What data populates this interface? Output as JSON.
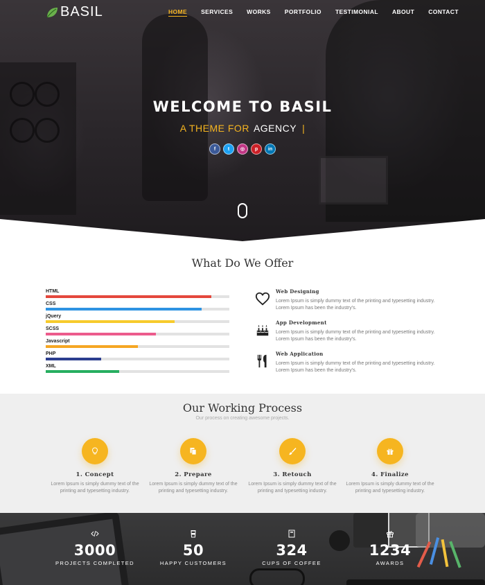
{
  "brand": {
    "name": "BASIL"
  },
  "nav": [
    {
      "label": "HOME",
      "active": true
    },
    {
      "label": "SERVICES"
    },
    {
      "label": "WORKS"
    },
    {
      "label": "PORTFOLIO"
    },
    {
      "label": "TESTIMONIAL"
    },
    {
      "label": "ABOUT"
    },
    {
      "label": "CONTACT"
    }
  ],
  "hero": {
    "title": "WELCOME TO BASIL",
    "sub_prefix": "A THEME FOR",
    "sub_word": "AGENCY",
    "cursor": "|",
    "social": [
      {
        "icon": "facebook-icon",
        "glyph": "f",
        "color": "#3b5998"
      },
      {
        "icon": "twitter-icon",
        "glyph": "t",
        "color": "#1da1f2"
      },
      {
        "icon": "instagram-icon",
        "glyph": "◎",
        "color": "#c13584"
      },
      {
        "icon": "pinterest-icon",
        "glyph": "p",
        "color": "#cb2027"
      },
      {
        "icon": "linkedin-icon",
        "glyph": "in",
        "color": "#0077b5"
      }
    ]
  },
  "offer": {
    "title": "What Do We Offer",
    "skills": [
      {
        "label": "HTML",
        "percent": 90,
        "color": "#e4473c"
      },
      {
        "label": "CSS",
        "percent": 85,
        "color": "#2e93e2"
      },
      {
        "label": "jQuery",
        "percent": 70,
        "color": "#f7cb2c"
      },
      {
        "label": "SCSS",
        "percent": 60,
        "color": "#ec5b8c"
      },
      {
        "label": "Javascript",
        "percent": 50,
        "color": "#f5a623"
      },
      {
        "label": "PHP",
        "percent": 30,
        "color": "#2c3e8f"
      },
      {
        "label": "XML",
        "percent": 40,
        "color": "#27ae60"
      }
    ],
    "services": [
      {
        "name": "Web Designing",
        "icon": "heart-icon",
        "desc": "Lorem Ipsum is simply dummy text of the printing and typesetting industry. Lorem Ipsum has been the industry's."
      },
      {
        "name": "App Development",
        "icon": "cake-icon",
        "desc": "Lorem Ipsum is simply dummy text of the printing and typesetting industry. Lorem Ipsum has been the industry's."
      },
      {
        "name": "Web Application",
        "icon": "cutlery-icon",
        "desc": "Lorem Ipsum is simply dummy text of the printing and typesetting industry. Lorem Ipsum has been the industry's."
      }
    ]
  },
  "process": {
    "title": "Our Working Process",
    "subtitle": "Our process on creating awesome projects.",
    "steps": [
      {
        "title": "1. Concept",
        "icon": "lightbulb-icon",
        "desc": "Lorem Ipsum is simply dummy text of the printing and typesetting industry."
      },
      {
        "title": "2. Prepare",
        "icon": "documents-icon",
        "desc": "Lorem Ipsum is simply dummy text of the printing and typesetting industry."
      },
      {
        "title": "3. Retouch",
        "icon": "paintbrush-icon",
        "desc": "Lorem Ipsum is simply dummy text of the printing and typesetting industry."
      },
      {
        "title": "4. Finalize",
        "icon": "gift-icon",
        "desc": "Lorem Ipsum is simply dummy text of the printing and typesetting industry."
      }
    ]
  },
  "stats": [
    {
      "number": "3000",
      "label": "PROJECTS COMPLETED",
      "icon": "code-icon"
    },
    {
      "number": "50",
      "label": "HAPPY CUSTOMERS",
      "icon": "cup-icon"
    },
    {
      "number": "324",
      "label": "CUPS OF COFFEE",
      "icon": "book-icon"
    },
    {
      "number": "1234",
      "label": "AWARDS",
      "icon": "gift-icon"
    }
  ]
}
